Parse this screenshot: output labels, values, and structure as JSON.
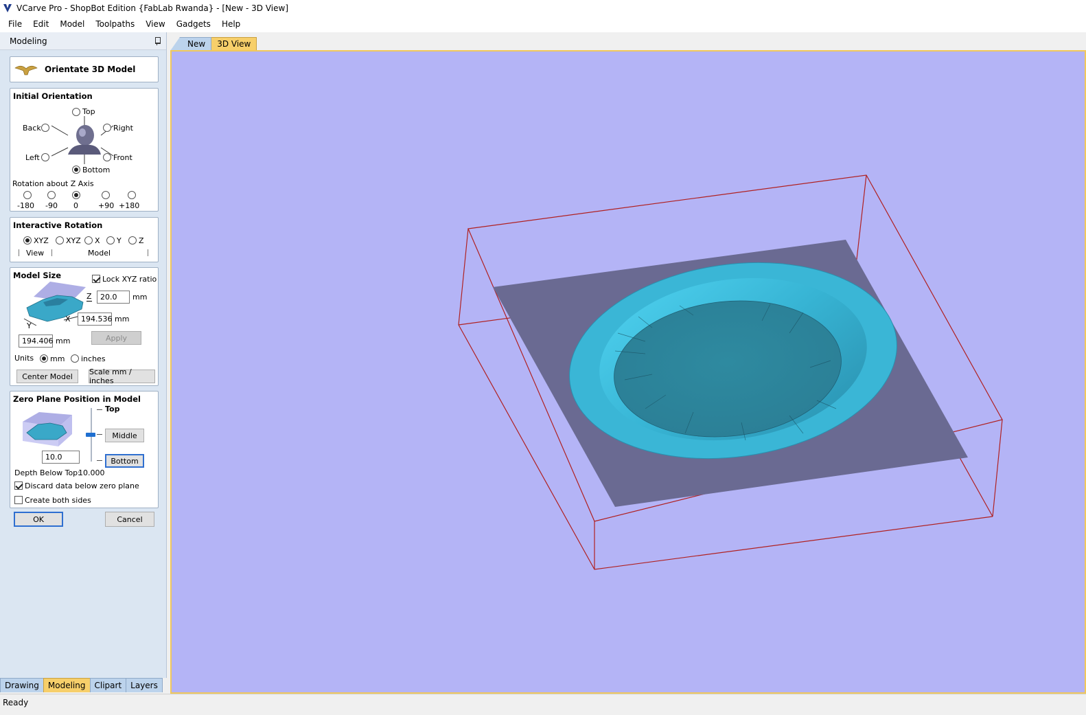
{
  "window": {
    "title": "VCarve Pro - ShopBot Edition {FabLab Rwanda} - [New - 3D View]"
  },
  "menu": [
    "File",
    "Edit",
    "Model",
    "Toolpaths",
    "View",
    "Gadgets",
    "Help"
  ],
  "panel": {
    "title": "Modeling",
    "heading": "Orientate 3D Model",
    "initial_orientation": {
      "title": "Initial Orientation",
      "top": "Top",
      "back": "Back",
      "right": "Right",
      "left": "Left",
      "front": "Front",
      "bottom": "Bottom",
      "selected": "Bottom"
    },
    "rotation_z": {
      "title": "Rotation about Z Axis",
      "options": [
        "-180",
        "-90",
        "0",
        "+90",
        "+180"
      ],
      "selected": "0"
    },
    "interactive_rotation": {
      "title": "Interactive Rotation",
      "options": [
        "XYZ",
        "XYZ",
        "X",
        "Y",
        "Z"
      ],
      "view_label": "View",
      "model_label": "Model"
    },
    "model_size": {
      "title": "Model Size",
      "lock_label": "Lock XYZ ratio",
      "lock_checked": true,
      "z_axis": "Z",
      "x_axis": "X",
      "y_axis": "Y",
      "z_value": "20.0",
      "x_value": "194.536",
      "y_value": "194.406",
      "unit_mm": "mm",
      "apply": "Apply",
      "units_label": "Units",
      "units_inches": "inches",
      "units_selected": "mm",
      "center_model": "Center Model",
      "scale": "Scale mm / inches"
    },
    "zero_plane": {
      "title": "Zero Plane Position in Model",
      "top": "Top",
      "middle": "Middle",
      "bottom": "Bottom",
      "value": "10.0",
      "depth_label": "Depth Below Top:",
      "depth_value": "10.000",
      "discard_label": "Discard data below zero plane",
      "discard_checked": true,
      "both_sides_label": "Create both sides",
      "both_sides_checked": false
    },
    "ok": "OK",
    "cancel": "Cancel"
  },
  "bottom_tabs": [
    "Drawing",
    "Modeling",
    "Clipart",
    "Layers"
  ],
  "bottom_tab_active": "Modeling",
  "view_tabs": [
    "New",
    "3D View"
  ],
  "view_tab_active": "3D View",
  "status": "Ready",
  "colors": {
    "viewport_bg": "#b4b4f6",
    "bounding_box": "#b02020",
    "model": "#3ab6d6",
    "zero_plane": "#6a6a92",
    "active_tab": "#f7cf6a"
  }
}
